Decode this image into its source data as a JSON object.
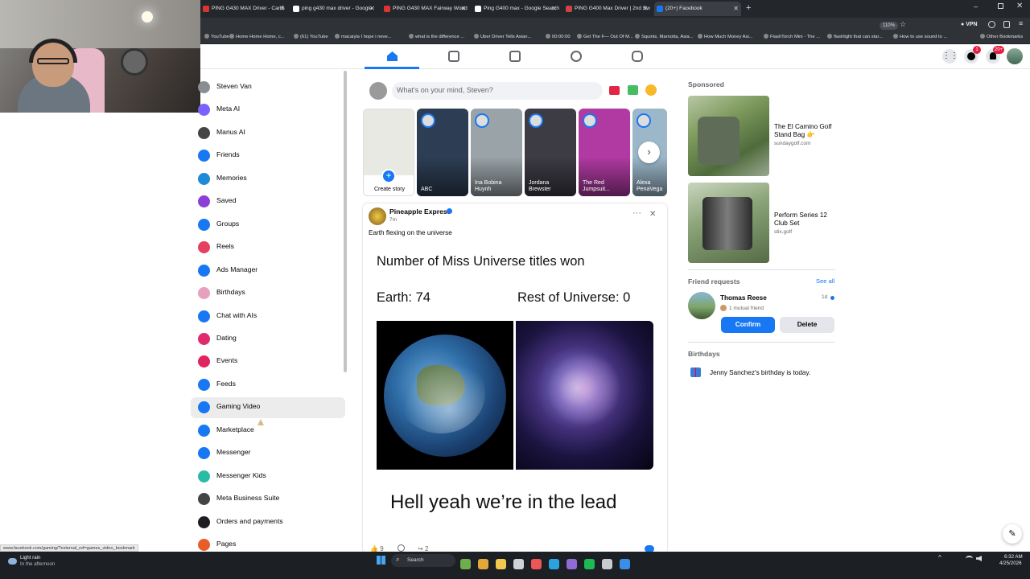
{
  "browser": {
    "tabs": [
      {
        "label": "PING G430 MAX Driver - CarlS",
        "color": "#d33"
      },
      {
        "label": "ping g430 max driver - Google",
        "color": "#fff"
      },
      {
        "label": "PING G430 MAX Fairway Wood",
        "color": "#d33"
      },
      {
        "label": "Ping G400 max - Google Search",
        "color": "#fff"
      },
      {
        "label": "PING G400 Max Driver | 2nd Swi",
        "color": "#c44"
      },
      {
        "label": "(20+) Facebook",
        "color": "#1877f2"
      }
    ],
    "zoom": "110%",
    "vpn": "VPN",
    "bookmarks": [
      "YouTube",
      "Home Home Home, c...",
      "(61) YouTube",
      "macaiyla I hope i neve...",
      "what is the difference ...",
      "Uber Driver Tells Asian...",
      "00:00:00",
      "Get The F— Out Of M...",
      "Squints, Marnotta, Asia...",
      "How Much Money Asi...",
      "FlashTorch Mini - The ...",
      "flashlight that can star...",
      "How to use sound to ...",
      "Other Bookmarks"
    ],
    "status_url": "www.facebook.com/gaming/?external_ref=games_video_bookmark"
  },
  "header": {
    "messenger_badge": "1",
    "notifications_badge": "20+"
  },
  "sidebar": {
    "items": [
      {
        "label": "Steven Van",
        "icon": "avatar",
        "color": "#8a8d91"
      },
      {
        "label": "Meta AI",
        "icon": "meta-ai-icon",
        "color": "#7b61ff"
      },
      {
        "label": "Manus AI",
        "icon": "manus-icon",
        "color": "#444"
      },
      {
        "label": "Friends",
        "icon": "friends-icon",
        "color": "#1877f2"
      },
      {
        "label": "Memories",
        "icon": "memories-icon",
        "color": "#1f8ad8"
      },
      {
        "label": "Saved",
        "icon": "saved-icon",
        "color": "#8c3fd6"
      },
      {
        "label": "Groups",
        "icon": "groups-icon",
        "color": "#1877f2"
      },
      {
        "label": "Reels",
        "icon": "reels-icon",
        "color": "#e4405f"
      },
      {
        "label": "Ads Manager",
        "icon": "ads-manager-icon",
        "color": "#1877f2"
      },
      {
        "label": "Birthdays",
        "icon": "birthdays-icon",
        "color": "#e8a0bf"
      },
      {
        "label": "Chat with AIs",
        "icon": "chat-ai-icon",
        "color": "#1877f2"
      },
      {
        "label": "Dating",
        "icon": "dating-icon",
        "color": "#e02c6d"
      },
      {
        "label": "Events",
        "icon": "events-icon",
        "color": "#e0245e"
      },
      {
        "label": "Feeds",
        "icon": "feeds-icon",
        "color": "#1877f2"
      },
      {
        "label": "Gaming Video",
        "icon": "gaming-video-icon",
        "color": "#1877f2"
      },
      {
        "label": "Marketplace",
        "icon": "marketplace-icon",
        "color": "#1877f2"
      },
      {
        "label": "Messenger",
        "icon": "messenger-icon",
        "color": "#1877f2"
      },
      {
        "label": "Messenger Kids",
        "icon": "messenger-kids-icon",
        "color": "#2abba7"
      },
      {
        "label": "Meta Business Suite",
        "icon": "business-suite-icon",
        "color": "#444"
      },
      {
        "label": "Orders and payments",
        "icon": "orders-icon",
        "color": "#1c1e21"
      },
      {
        "label": "Pages",
        "icon": "pages-icon",
        "color": "#e95d2a"
      }
    ]
  },
  "composer": {
    "placeholder": "What's on your mind, Steven?"
  },
  "stories": [
    {
      "label": "Create story",
      "color": "#e9e9e4"
    },
    {
      "label": "ABC",
      "color": "#2d3e54"
    },
    {
      "label": "Ina Bobina Huynh",
      "color": "#9aa3a8"
    },
    {
      "label": "Jordana Brewster",
      "color": "#3d3b44"
    },
    {
      "label": "The Red Jumpsuit...",
      "color": "#b03aa2"
    },
    {
      "label": "Alexa PenaVega",
      "color": "#9bb7c9"
    }
  ],
  "post": {
    "author": "Pineapple Express",
    "time": "7m",
    "caption": "Earth flexing on the universe",
    "meme_title": "Number of Miss Universe titles won",
    "earth_label": "Earth: 74",
    "rest_label": "Rest of Universe: 0",
    "bottom_text": "Hell yeah we’re in the lead",
    "likes": "9",
    "shares": "2"
  },
  "sponsored": {
    "heading": "Sponsored",
    "ads": [
      {
        "title": "The El Camino Golf Stand Bag 👉",
        "site": "sundaygolf.com"
      },
      {
        "title": "Perform Series 12 Club Set",
        "site": "stix.golf"
      }
    ]
  },
  "friend_requests": {
    "heading": "Friend requests",
    "see_all": "See all",
    "name": "Thomas Reese",
    "mutual": "1 mutual friend",
    "age": "1d",
    "confirm": "Confirm",
    "delete": "Delete"
  },
  "birthdays": {
    "heading": "Birthdays",
    "name": "Jenny Sanchez",
    "text": "'s birthday is today."
  },
  "taskbar": {
    "weather_title": "Light rain",
    "weather_sub": "In the afternoon",
    "search": "Search",
    "time": "6:32 AM",
    "date": "4/25/2026"
  }
}
